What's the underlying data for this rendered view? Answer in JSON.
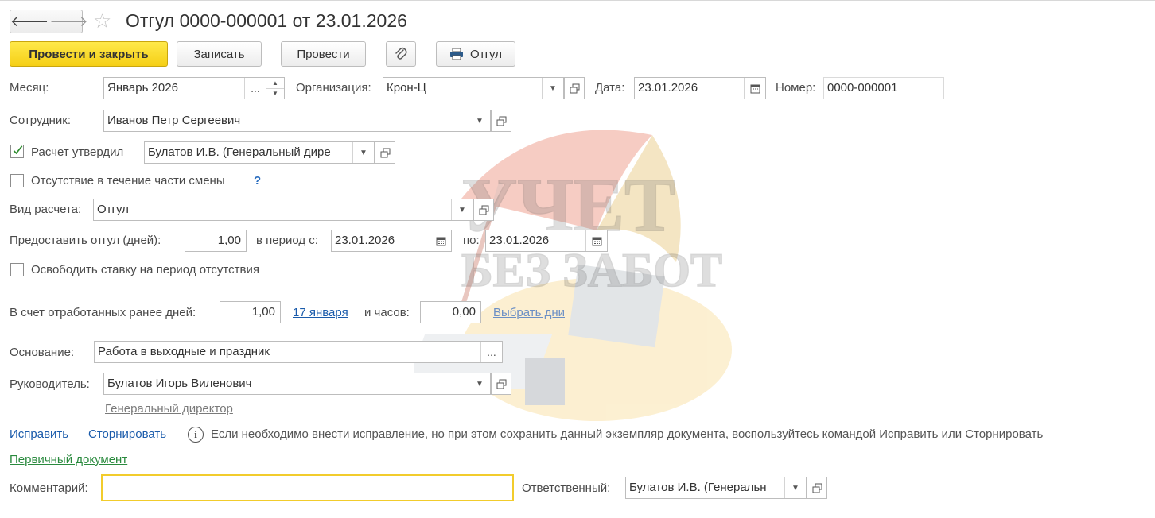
{
  "window": {
    "title": "Отгул 0000-000001 от 23.01.2026",
    "nav_back": "🡐",
    "nav_forward": "🡒",
    "favorite_icon": "☆"
  },
  "toolbar": {
    "post_close": "Провести и закрыть",
    "save": "Записать",
    "post": "Провести",
    "attach_icon": "paperclip-icon",
    "print_label": "Отгул"
  },
  "form": {
    "month_label": "Месяц:",
    "month_value": "Январь 2026",
    "org_label": "Организация:",
    "org_value": "Крон-Ц",
    "date_label": "Дата:",
    "date_value": "23.01.2026",
    "number_label": "Номер:",
    "number_value": "0000-000001",
    "employee_label": "Сотрудник:",
    "employee_value": "Иванов Петр Сергеевич",
    "approved_label": "Расчет утвердил",
    "approved_checked": true,
    "approved_value": "Булатов И.В. (Генеральный дире",
    "partial_label": "Отсутствие в течение части смены",
    "partial_checked": false,
    "help_mark": "?",
    "calc_type_label": "Вид расчета:",
    "calc_type_value": "Отгул",
    "days_label": "Предоставить отгул (дней):",
    "days_value": "1,00",
    "period_from_label": "в период с:",
    "period_from_value": "23.01.2026",
    "period_to_label": "по:",
    "period_to_value": "23.01.2026",
    "release_label": "Освободить ставку на период отсутствия",
    "release_checked": false,
    "worked_days_label": "В счет отработанных ранее дней:",
    "worked_days_value": "1,00",
    "worked_date_link": "17 января",
    "hours_label": "и часов:",
    "hours_value": "0,00",
    "choose_days_link": "Выбрать дни",
    "basis_label": "Основание:",
    "basis_value": "Работа в выходные и праздник",
    "manager_label": "Руководитель:",
    "manager_value": "Булатов Игорь Виленович",
    "manager_position": "Генеральный директор",
    "fix_link": "Исправить",
    "storno_link": "Сторнировать",
    "info_text": "Если необходимо внести исправление, но при этом сохранить данный экземпляр документа, воспользуйтесь командой Исправить или Сторнировать",
    "primary_doc_link": "Первичный документ",
    "comment_label": "Комментарий:",
    "comment_value": "",
    "responsible_label": "Ответственный:",
    "responsible_value": "Булатов И.В. (Генеральн"
  },
  "watermark": {
    "line1": "УЧЕТ",
    "line2": "БЕЗ ЗАБОТ"
  },
  "colors": {
    "primary_button": "#f5cf16",
    "link": "#1a5bab",
    "link_green": "#2a8a3e",
    "comment_border": "#f2cc2c"
  }
}
